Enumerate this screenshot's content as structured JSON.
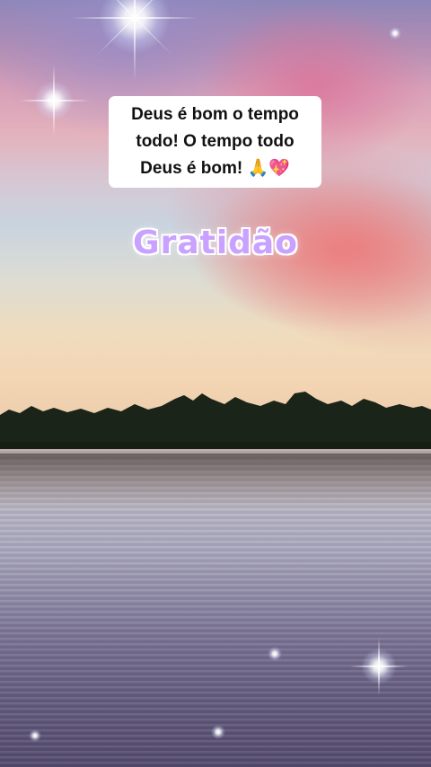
{
  "caption": {
    "text": "Deus é bom o tempo\ntodo! O tempo todo\nDeus é bom! 🙏💖"
  },
  "overlay_title": "Gratidão",
  "sparkles": [
    "sparkle-icon",
    "sparkle-icon",
    "sparkle-icon",
    "sparkle-icon",
    "sparkle-icon",
    "sparkle-icon",
    "sparkle-icon"
  ],
  "colors": {
    "title_fill": "#c9a1ff",
    "caption_bg": "#ffffff",
    "caption_text": "#111111"
  }
}
